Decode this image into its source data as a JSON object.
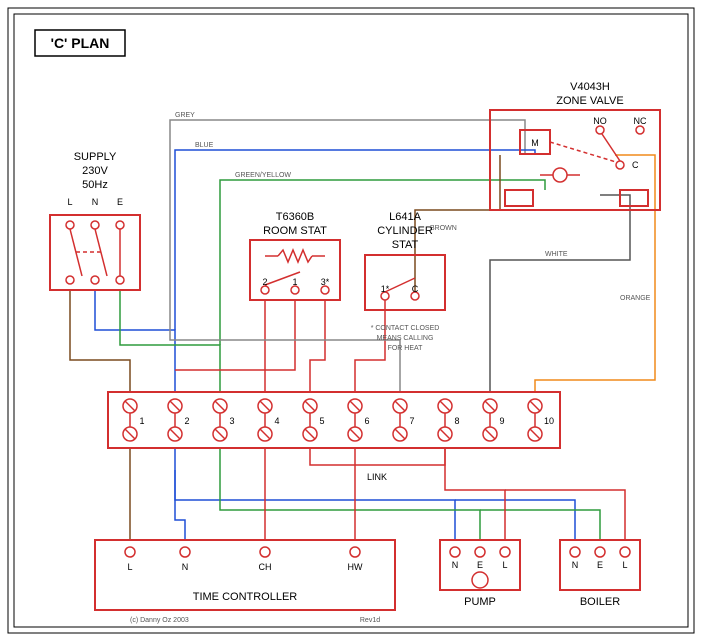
{
  "title": "'C' PLAN",
  "supply": {
    "label1": "SUPPLY",
    "label2": "230V",
    "label3": "50Hz",
    "L": "L",
    "N": "N",
    "E": "E"
  },
  "room_stat": {
    "label1": "T6360B",
    "label2": "ROOM STAT",
    "t1": "2",
    "t2": "1",
    "t3": "3*"
  },
  "cyl_stat": {
    "label1": "L641A",
    "label2": "CYLINDER",
    "label3": "STAT",
    "t1": "1*",
    "t2": "C",
    "note1": "* CONTACT CLOSED",
    "note2": "MEANS CALLING",
    "note3": "FOR HEAT"
  },
  "zone_valve": {
    "label1": "V4043H",
    "label2": "ZONE VALVE",
    "M": "M",
    "NO": "NO",
    "NC": "NC",
    "C": "C"
  },
  "junction": {
    "t1": "1",
    "t2": "2",
    "t3": "3",
    "t4": "4",
    "t5": "5",
    "t6": "6",
    "t7": "7",
    "t8": "8",
    "t9": "9",
    "t10": "10",
    "link": "LINK"
  },
  "time_controller": {
    "label": "TIME CONTROLLER",
    "L": "L",
    "N": "N",
    "CH": "CH",
    "HW": "HW"
  },
  "pump": {
    "label": "PUMP",
    "N": "N",
    "E": "E",
    "L": "L"
  },
  "boiler": {
    "label": "BOILER",
    "N": "N",
    "E": "E",
    "L": "L"
  },
  "wire_labels": {
    "grey": "GREY",
    "blue": "BLUE",
    "green": "GREEN/YELLOW",
    "brown": "BROWN",
    "white": "WHITE",
    "orange": "ORANGE"
  },
  "footer": {
    "copyright": "(c) Danny Oz 2003",
    "rev": "Rev1d"
  }
}
